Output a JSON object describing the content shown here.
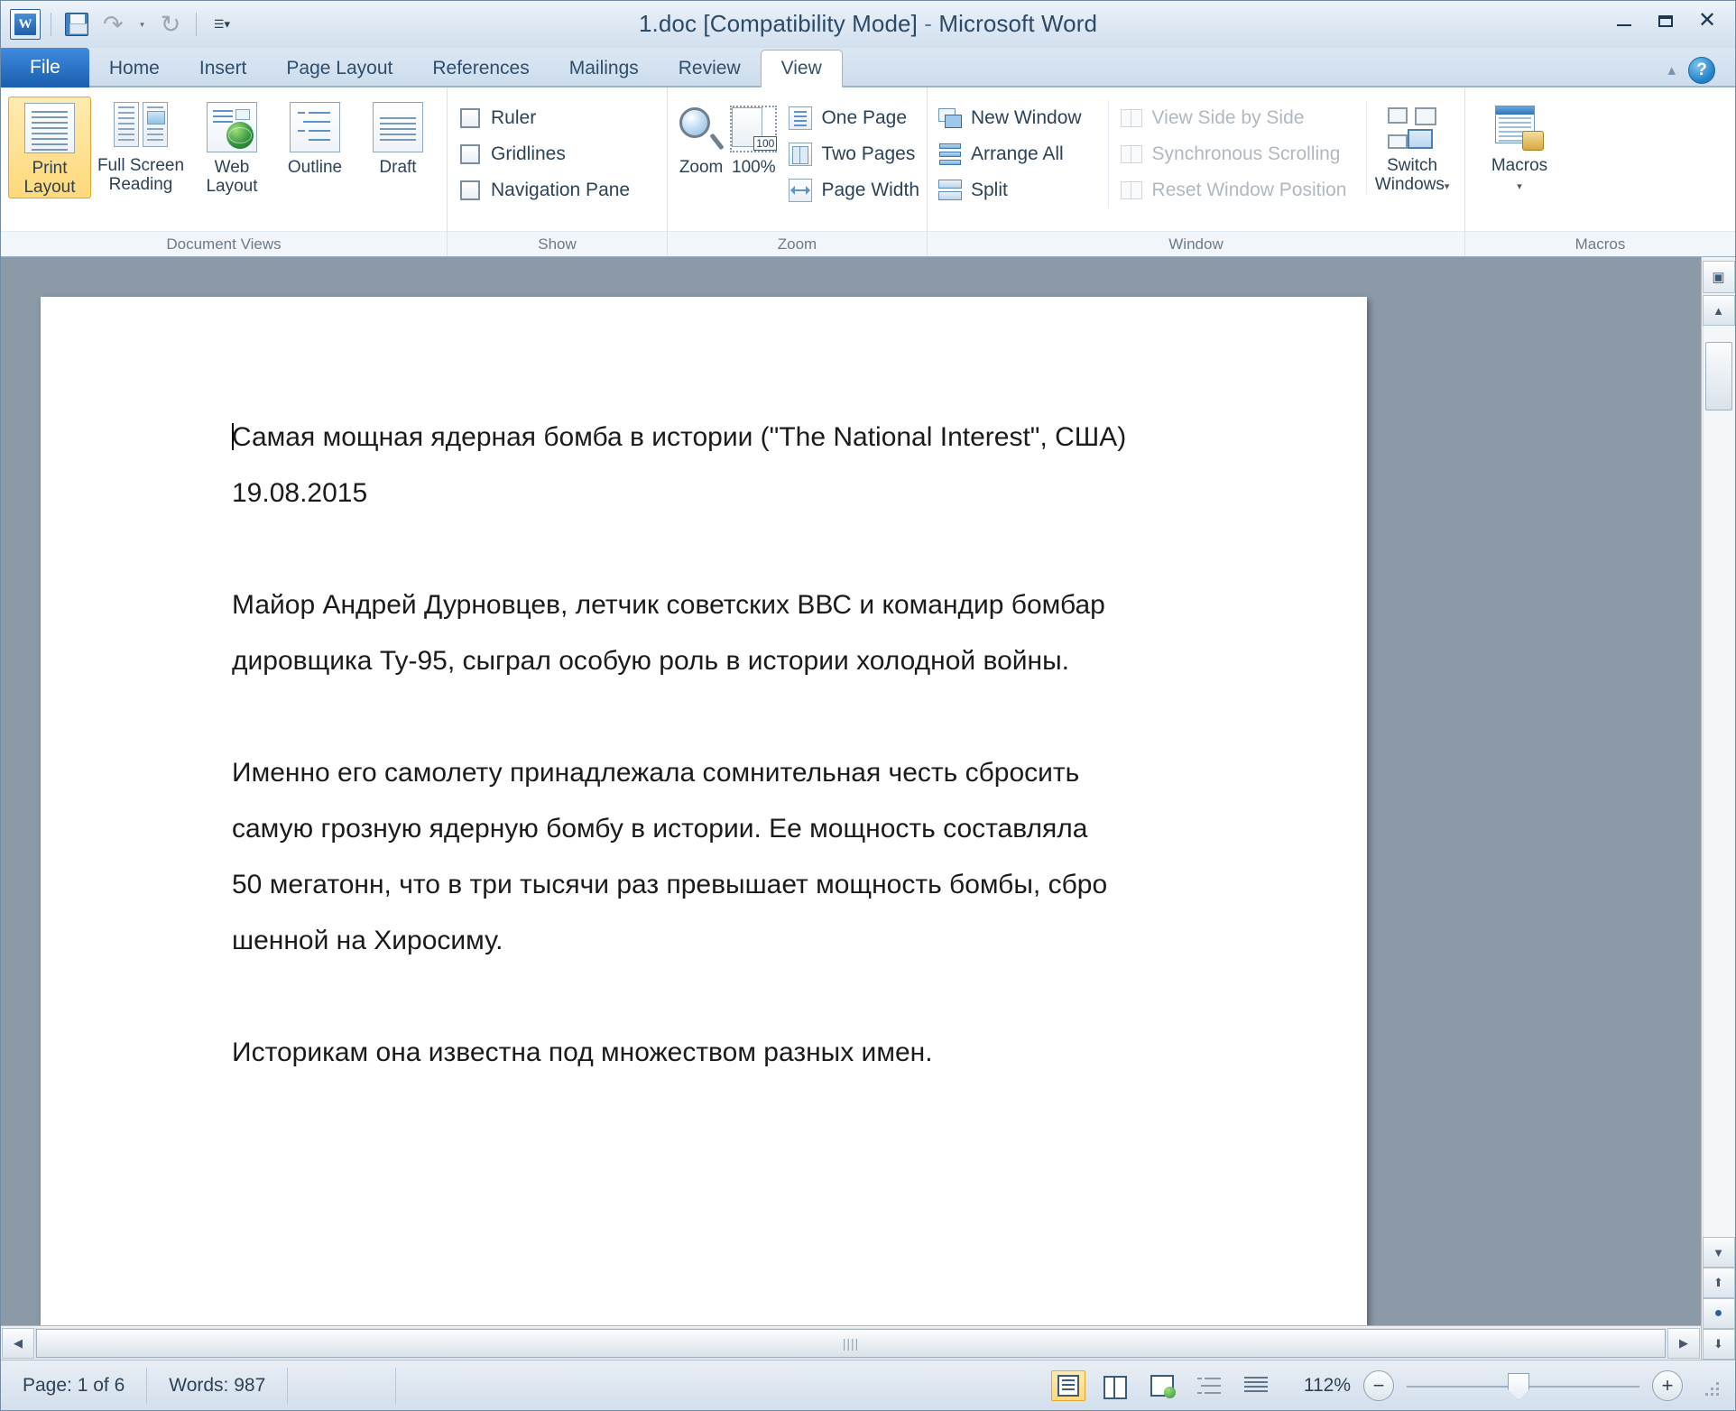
{
  "window": {
    "title": "1.doc [Compatibility Mode]",
    "title_sep": "-",
    "app_name": "Microsoft Word",
    "logo_letter": "W",
    "minimize": "minimize",
    "maximize": "maximize",
    "close": "✕"
  },
  "quick_access": {
    "save": "Save",
    "undo": "↶",
    "undo_caret": "▾",
    "redo": "↻",
    "customize": "▾"
  },
  "tabs": [
    {
      "label": "File",
      "active": false,
      "style": "file"
    },
    {
      "label": "Home",
      "active": false
    },
    {
      "label": "Insert",
      "active": false
    },
    {
      "label": "Page Layout",
      "active": false
    },
    {
      "label": "References",
      "active": false
    },
    {
      "label": "Mailings",
      "active": false
    },
    {
      "label": "Review",
      "active": false
    },
    {
      "label": "View",
      "active": true
    }
  ],
  "tab_right": {
    "minimize_ribbon": "▴",
    "help": "?"
  },
  "ribbon": {
    "groups": [
      {
        "name": "Document Views",
        "label": "Document Views",
        "buttons": [
          {
            "label_1": "Print",
            "label_2": "Layout",
            "selected": true
          },
          {
            "label_1": "Full Screen",
            "label_2": "Reading",
            "selected": false
          },
          {
            "label_1": "Web",
            "label_2": "Layout",
            "selected": false
          },
          {
            "label_1": "Outline",
            "label_2": "",
            "selected": false
          },
          {
            "label_1": "Draft",
            "label_2": "",
            "selected": false
          }
        ]
      },
      {
        "name": "Show",
        "label": "Show",
        "checks": [
          {
            "label": "Ruler",
            "checked": false
          },
          {
            "label": "Gridlines",
            "checked": false
          },
          {
            "label": "Navigation Pane",
            "checked": false
          }
        ]
      },
      {
        "name": "Zoom",
        "label": "Zoom",
        "big": [
          {
            "label": "Zoom"
          },
          {
            "label": "100%",
            "badge": "100"
          }
        ],
        "small": [
          {
            "label": "One Page"
          },
          {
            "label": "Two Pages"
          },
          {
            "label": "Page Width"
          }
        ]
      },
      {
        "name": "Window",
        "label": "Window",
        "col_a": [
          {
            "label": "New Window",
            "disabled": false
          },
          {
            "label": "Arrange All",
            "disabled": false
          },
          {
            "label": "Split",
            "disabled": false
          }
        ],
        "col_b": [
          {
            "label": "View Side by Side",
            "disabled": true
          },
          {
            "label": "Synchronous Scrolling",
            "disabled": true
          },
          {
            "label": "Reset Window Position",
            "disabled": true
          }
        ],
        "switch": {
          "label_1": "Switch",
          "label_2": "Windows",
          "caret": "▾"
        }
      },
      {
        "name": "Macros",
        "label": "Macros",
        "button": {
          "label_1": "Macros",
          "caret": "▾"
        }
      }
    ]
  },
  "document": {
    "paragraphs": [
      "Самая мощная ядерная бомба в истории (\"The National Interest\", США)",
      "19.08.2015",
      "",
      "Майор Андрей Дурновцев, летчик советских ВВС и командир бомбар",
      "дировщика Ту-95, сыграл особую роль в истории холодной войны.",
      "",
      "Именно его самолету принадлежала сомнительная честь сбросить",
      "самую грозную ядерную бомбу в истории. Ее мощность составляла",
      "50 мегатонн, что в три тысячи раз превышает мощность бомбы, сбро",
      "шенной на Хиросиму.",
      "",
      "Историкам она известна под множеством разных имен."
    ]
  },
  "scrollbars": {
    "up_arrow": "▲",
    "down_arrow": "▼",
    "left_arrow": "◀",
    "right_arrow": "▶",
    "prev_page": "⬆",
    "select_browse": "●",
    "next_page": "⬇",
    "h_grip": "||||"
  },
  "status": {
    "page": "Page: 1 of 6",
    "words": "Words: 987",
    "zoom_percent": "112%",
    "zoom_out": "−",
    "zoom_in": "+",
    "views": [
      {
        "name": "print-layout",
        "selected": true
      },
      {
        "name": "full-screen-reading",
        "selected": false
      },
      {
        "name": "web-layout",
        "selected": false
      },
      {
        "name": "outline",
        "selected": false
      },
      {
        "name": "draft",
        "selected": false
      }
    ]
  }
}
